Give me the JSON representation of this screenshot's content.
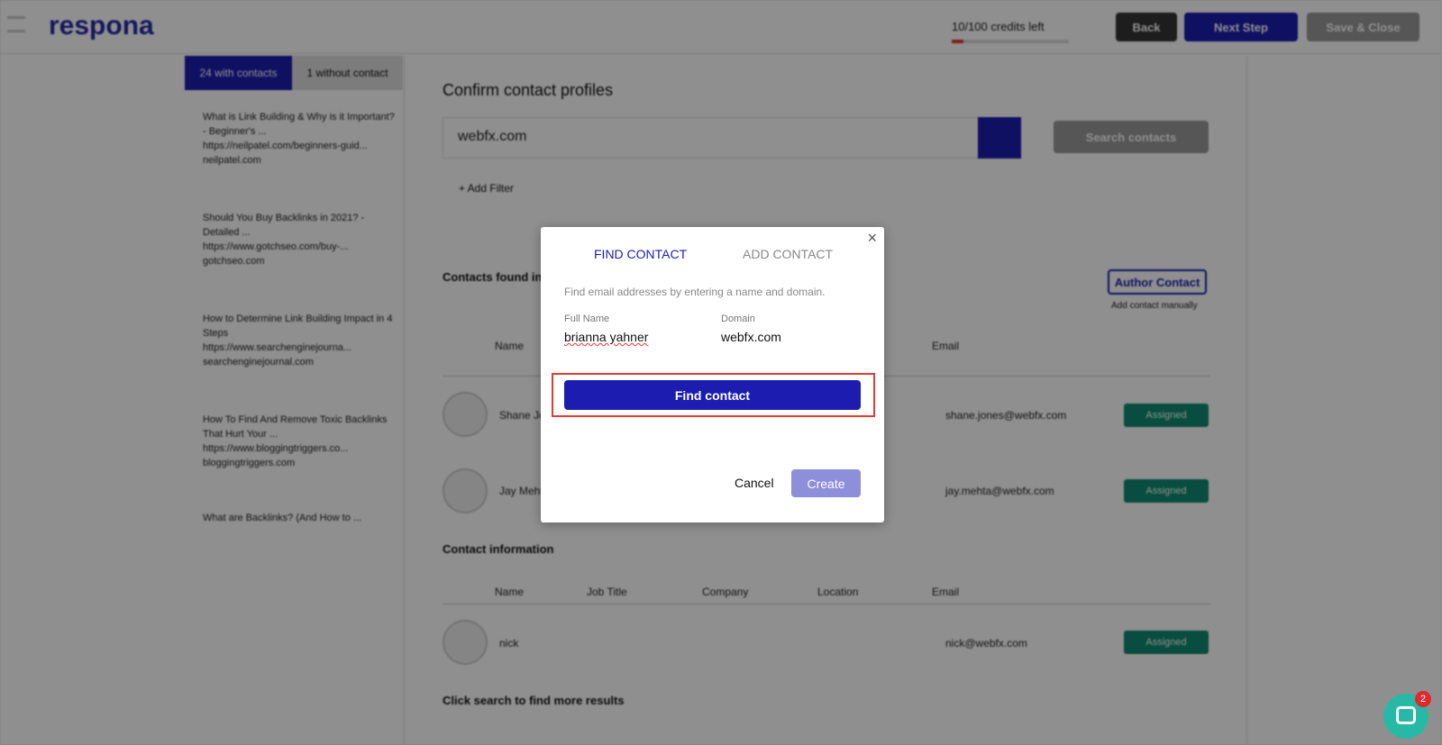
{
  "header": {
    "logo": "respona",
    "credits": "10/100 credits left",
    "credits_fraction": 0.1,
    "back": "Back",
    "next": "Next Step",
    "save": "Save & Close"
  },
  "sidebar": {
    "tabs": [
      "24 with contacts",
      "1 without contact"
    ],
    "items": [
      {
        "title": "What is Link Building & Why is it Important? - Beginner's ...",
        "url": "https://neilpatel.com/beginners-guid...",
        "domain": "neilpatel.com"
      },
      {
        "title": "Should You Buy Backlinks in 2021? - Detailed ...",
        "url": "https://www.gotchseo.com/buy-...",
        "domain": "gotchseo.com"
      },
      {
        "title": "How to Determine Link Building Impact in 4 Steps",
        "url": "https://www.searchenginejourna...",
        "domain": "searchenginejournal.com"
      },
      {
        "title": "How To Find And Remove Toxic Backlinks That Hurt Your ...",
        "url": "https://www.bloggingtriggers.co...",
        "domain": "bloggingtriggers.com"
      },
      {
        "title": "What are Backlinks? (And How to ..."
      }
    ]
  },
  "main": {
    "title": "Confirm contact profiles",
    "search_value": "webfx.com",
    "search_contacts": "Search contacts",
    "add_filter": "+ Add Filter",
    "contacts_found": "Contacts found in",
    "author_contact": "Author Contact",
    "add_manually": "Add contact manually",
    "col_name": "Name",
    "col_email": "Email",
    "rows": [
      {
        "name": "Shane Jones",
        "email": "shane.jones@webfx.com",
        "status": "Assigned"
      },
      {
        "name": "Jay Mehta",
        "email": "jay.mehta@webfx.com",
        "status": "Assigned"
      }
    ],
    "contact_info": "Contact information",
    "info_cols": [
      "Name",
      "Job Title",
      "Company",
      "Location",
      "Email"
    ],
    "info_row": {
      "name": "nick",
      "email": "nick@webfx.com",
      "status": "Assigned"
    },
    "more": "Click search to find more results"
  },
  "modal": {
    "tab_find": "FIND CONTACT",
    "tab_add": "ADD CONTACT",
    "desc": "Find email addresses by entering a name and domain.",
    "full_name_label": "Full Name",
    "full_name_value": "brianna yahner",
    "domain_label": "Domain",
    "domain_value": "webfx.com",
    "find_button": "Find contact",
    "cancel": "Cancel",
    "create": "Create",
    "accent": "#1c1db0"
  },
  "chat": {
    "badge": "2"
  }
}
